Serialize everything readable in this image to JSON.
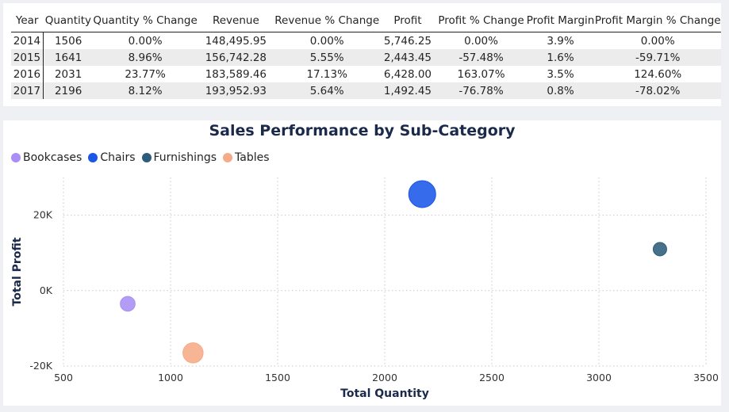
{
  "table": {
    "headers": [
      "Year",
      "Quantity",
      "Quantity % Change",
      "Revenue",
      "Revenue % Change",
      "Profit",
      "Profit % Change",
      "Profit Margin",
      "Profit Margin % Change"
    ],
    "rows": [
      [
        "2014",
        "1506",
        "0.00%",
        "148,495.95",
        "0.00%",
        "5,746.25",
        "0.00%",
        "3.9%",
        "0.00%"
      ],
      [
        "2015",
        "1641",
        "8.96%",
        "156,742.28",
        "5.55%",
        "2,443.45",
        "-57.48%",
        "1.6%",
        "-59.71%"
      ],
      [
        "2016",
        "2031",
        "23.77%",
        "183,589.46",
        "17.13%",
        "6,428.00",
        "163.07%",
        "3.5%",
        "124.60%"
      ],
      [
        "2017",
        "2196",
        "8.12%",
        "193,952.93",
        "5.64%",
        "1,492.45",
        "-76.78%",
        "0.8%",
        "-78.02%"
      ]
    ]
  },
  "chart_data": {
    "type": "scatter",
    "title": "Sales Performance by Sub-Category",
    "xlabel": "Total Quantity",
    "ylabel": "Total Profit",
    "xlim": [
      500,
      3500
    ],
    "ylim": [
      -20000,
      30000
    ],
    "x_ticks": [
      500,
      1000,
      1500,
      2000,
      2500,
      3000,
      3500
    ],
    "x_tick_labels": [
      "500",
      "1000",
      "1500",
      "2000",
      "2500",
      "3000",
      "3500"
    ],
    "y_ticks": [
      -20000,
      0,
      20000
    ],
    "y_tick_labels": [
      "-20K",
      "0K",
      "20K"
    ],
    "grid": true,
    "legend_position": "top-left",
    "series": [
      {
        "name": "Bookcases",
        "color": "#a98ef5",
        "x": 800,
        "y": -3500,
        "size": 0.55
      },
      {
        "name": "Chairs",
        "color": "#1a56e8",
        "x": 2175,
        "y": 25600,
        "size": 1.0
      },
      {
        "name": "Furnishings",
        "color": "#2d5c7a",
        "x": 3285,
        "y": 11000,
        "size": 0.5
      },
      {
        "name": "Tables",
        "color": "#f6ab88",
        "x": 1105,
        "y": -16500,
        "size": 0.75
      }
    ]
  }
}
